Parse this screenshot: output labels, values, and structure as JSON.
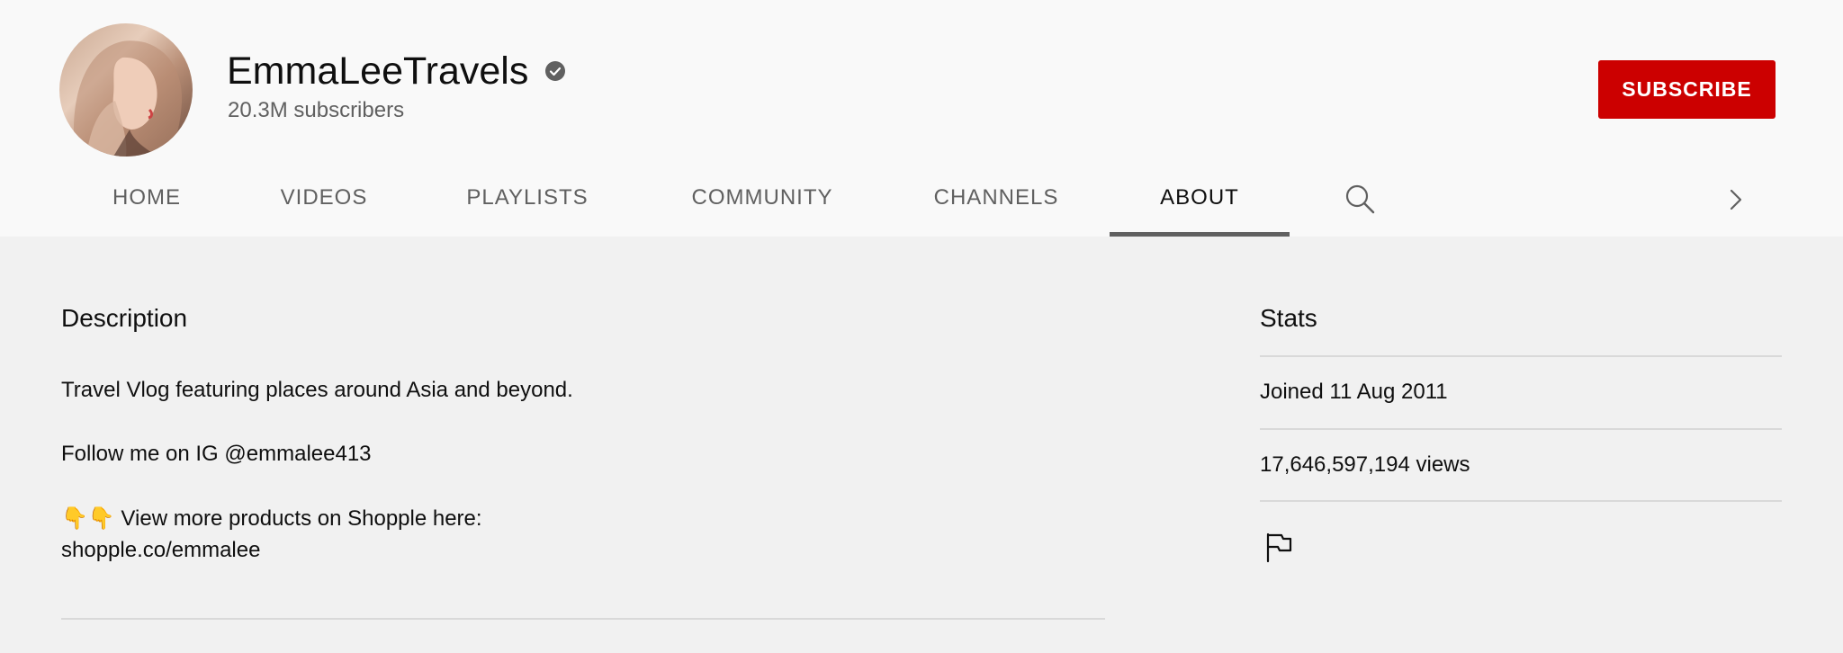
{
  "channel": {
    "name": "EmmaLeeTravels",
    "subscribers": "20.3M subscribers",
    "subscribe_label": "SUBSCRIBE"
  },
  "tabs": [
    {
      "label": "HOME"
    },
    {
      "label": "VIDEOS"
    },
    {
      "label": "PLAYLISTS"
    },
    {
      "label": "COMMUNITY"
    },
    {
      "label": "CHANNELS"
    },
    {
      "label": "ABOUT",
      "active": true
    }
  ],
  "description": {
    "title": "Description",
    "lines": [
      "Travel Vlog featuring places around Asia and beyond.",
      "Follow me on IG @emmalee413",
      "👇👇 View more products on Shopple here:",
      "shopple.co/emmalee"
    ]
  },
  "stats": {
    "title": "Stats",
    "joined": "Joined 11 Aug 2011",
    "views": "17,646,597,194 views"
  },
  "icons": {
    "verified": "verified-check-icon",
    "search": "search-icon",
    "next": "chevron-right-icon",
    "report": "flag-icon"
  },
  "colors": {
    "subscribe": "#cc0000",
    "header_bg": "#f9f9f9",
    "page_bg": "#f1f1f1"
  }
}
